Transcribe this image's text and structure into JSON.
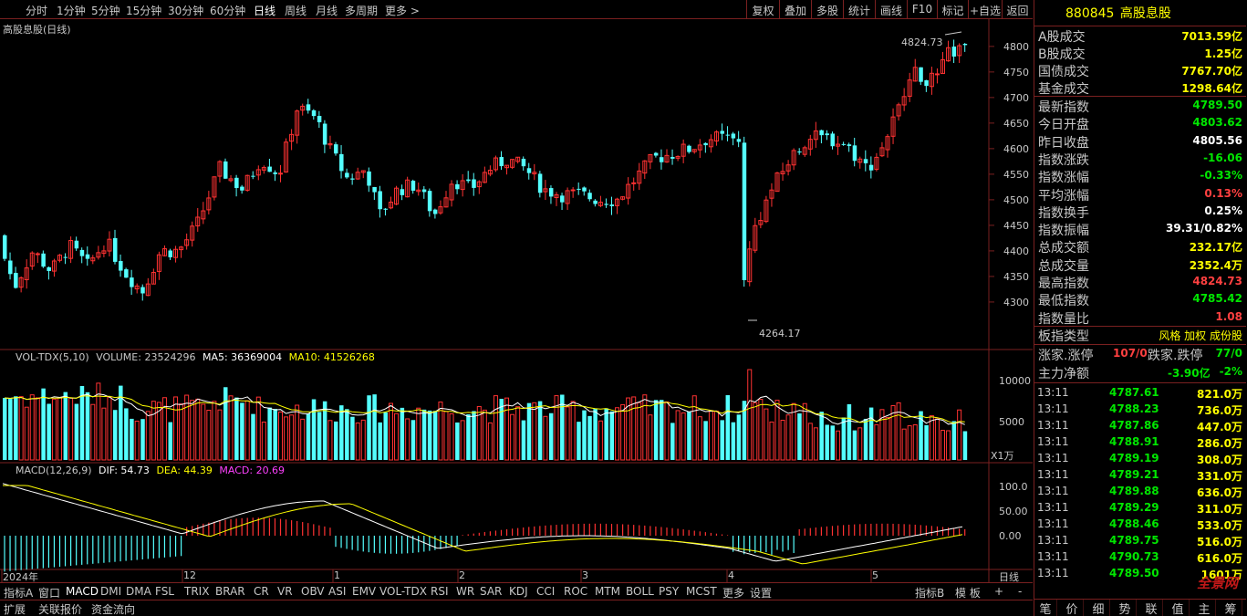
{
  "toolbar": {
    "periods": [
      "分时",
      "1分钟",
      "5分钟",
      "15分钟",
      "30分钟",
      "60分钟",
      "日线",
      "周线",
      "月线",
      "多周期",
      "更多 >"
    ],
    "active_period": "日线",
    "right_buttons": [
      "复权",
      "叠加",
      "多股",
      "统计",
      "画线",
      "F10",
      "标记",
      "+自选",
      "返回"
    ]
  },
  "main_chart": {
    "title": "高股息股(日线)",
    "high_label": "4824.73",
    "low_label": "4264.17",
    "y_ticks": [
      "4800",
      "4750",
      "4700",
      "4650",
      "4600",
      "4550",
      "4500",
      "4450",
      "4400",
      "4350",
      "4300"
    ]
  },
  "volume_chart": {
    "title": "VOL-TDX(5,10)",
    "volume_label": "VOLUME: 23524296",
    "ma5_label": "MA5: 36369004",
    "ma10_label": "MA10: 41526268",
    "y_ticks": [
      "10000",
      "5000"
    ],
    "unit": "X1万",
    "colors": {
      "ma5": "#ffffff",
      "ma10": "#ffff00"
    }
  },
  "macd_chart": {
    "title": "MACD(12,26,9)",
    "dif_label": "DIF: 54.73",
    "dea_label": "DEA: 44.39",
    "macd_label": "MACD: 20.69",
    "y_ticks": [
      "100.0",
      "50.00",
      "0.00"
    ],
    "colors": {
      "dif": "#ffffff",
      "dea": "#ffff00",
      "macd": "#ff40ff"
    }
  },
  "chart_data": {
    "type": "candlestick",
    "title": "高股息股(日线)",
    "ylim": [
      4264.17,
      4824.73
    ],
    "high": 4824.73,
    "low": 4264.17,
    "x_labels": [
      "2024年",
      "12",
      "1",
      "2",
      "3",
      "4",
      "5"
    ],
    "period_label": "日线",
    "colors": {
      "up": "#ff3232",
      "down": "#54ffff"
    }
  },
  "bottom_tabs": [
    "指标A",
    "窗口",
    "MACD",
    "DMI",
    "DMA",
    "FSL",
    "TRIX",
    "BRAR",
    "CR",
    "VR",
    "OBV",
    "ASI",
    "EMV",
    "VOL-TDX",
    "RSI",
    "WR",
    "SAR",
    "KDJ",
    "CCI",
    "ROC",
    "MTM",
    "BOLL",
    "PSY",
    "MCST",
    "更多",
    "设置"
  ],
  "bottom_right": [
    "指标B",
    "模 板",
    "+",
    "-"
  ],
  "status_tabs": [
    "扩展",
    "关联报价",
    "资金流向"
  ],
  "right_panel": {
    "code": "880845",
    "name": "高股息股",
    "turnover": [
      {
        "label": "A股成交",
        "value": "7013.59亿"
      },
      {
        "label": "B股成交",
        "value": "1.25亿"
      },
      {
        "label": "国债成交",
        "value": "7767.70亿"
      },
      {
        "label": "基金成交",
        "value": "1298.64亿"
      }
    ],
    "stats": [
      {
        "label": "最新指数",
        "value": "4789.50",
        "color": "#00e600"
      },
      {
        "label": "今日开盘",
        "value": "4803.62",
        "color": "#00e600"
      },
      {
        "label": "昨日收盘",
        "value": "4805.56",
        "color": "#ffffff"
      },
      {
        "label": "指数涨跌",
        "value": "-16.06",
        "color": "#00e600"
      },
      {
        "label": "指数涨幅",
        "value": "-0.33%",
        "color": "#00e600"
      },
      {
        "label": "平均涨幅",
        "value": "0.13%",
        "color": "#ff4040"
      },
      {
        "label": "指数换手",
        "value": "0.25%",
        "color": "#ffffff"
      },
      {
        "label": "指数振幅",
        "value": "39.31/0.82%",
        "color": "#ffffff"
      },
      {
        "label": "总成交额",
        "value": "232.17亿",
        "color": "#ffff00"
      },
      {
        "label": "总成交量",
        "value": "2352.4万",
        "color": "#ffff00"
      },
      {
        "label": "最高指数",
        "value": "4824.73",
        "color": "#ff4040"
      },
      {
        "label": "最低指数",
        "value": "4785.42",
        "color": "#00e600"
      },
      {
        "label": "指数量比",
        "value": "1.08",
        "color": "#ff4040"
      }
    ],
    "index_type_label": "板指类型",
    "index_type_value": "风格 加权 成份股",
    "up_label": "涨家.涨停",
    "up_value": "107/0",
    "down_label": "跌家.跌停",
    "down_value": "77/0",
    "net_flow_label": "主力净额",
    "net_flow_value": "-3.90亿",
    "net_flow_pct": "-2%",
    "ticks": [
      {
        "time": "13:11",
        "price": "4787.61",
        "vol": "821.0万"
      },
      {
        "time": "13:11",
        "price": "4788.23",
        "vol": "736.0万"
      },
      {
        "time": "13:11",
        "price": "4787.86",
        "vol": "447.0万"
      },
      {
        "time": "13:11",
        "price": "4788.91",
        "vol": "286.0万"
      },
      {
        "time": "13:11",
        "price": "4789.19",
        "vol": "308.0万"
      },
      {
        "time": "13:11",
        "price": "4789.21",
        "vol": "331.0万"
      },
      {
        "time": "13:11",
        "price": "4789.88",
        "vol": "636.0万"
      },
      {
        "time": "13:11",
        "price": "4789.29",
        "vol": "311.0万"
      },
      {
        "time": "13:11",
        "price": "4788.46",
        "vol": "533.0万"
      },
      {
        "time": "13:11",
        "price": "4789.75",
        "vol": "516.0万"
      },
      {
        "time": "13:11",
        "price": "4790.73",
        "vol": "616.0万"
      },
      {
        "time": "13:11",
        "price": "4789.50",
        "vol": "1601万"
      }
    ],
    "bottom_tabs": [
      "笔",
      "价",
      "细",
      "势",
      "联",
      "值",
      "主",
      "筹"
    ],
    "watermark": "全景网"
  }
}
